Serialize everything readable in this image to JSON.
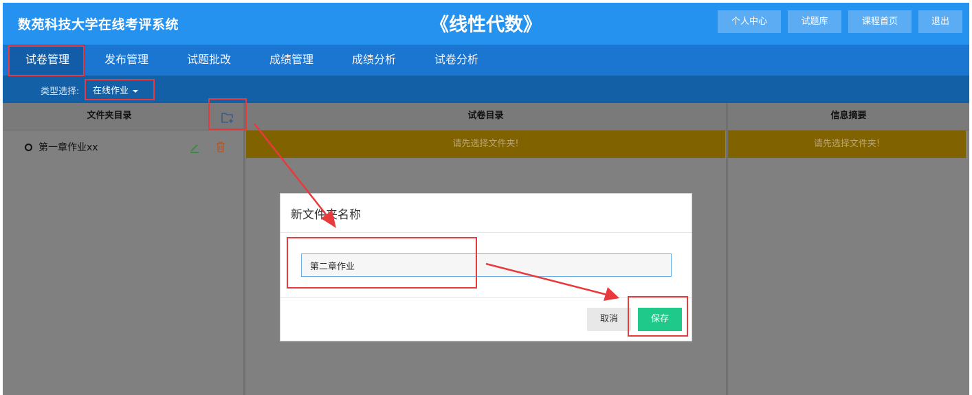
{
  "header": {
    "brand": "数苑科技大学在线考评系统",
    "course_title": "《线性代数》",
    "buttons": [
      "个人中心",
      "试题库",
      "课程首页",
      "退出"
    ]
  },
  "nav": {
    "tabs": [
      "试卷管理",
      "发布管理",
      "试题批改",
      "成绩管理",
      "成绩分析",
      "试卷分析"
    ],
    "active": "试卷管理"
  },
  "typebar": {
    "label": "类型选择:",
    "value": "在线作业"
  },
  "panels": {
    "folder_header": "文件夹目录",
    "paper_header": "试卷目录",
    "summary_header": "信息摘要",
    "paper_warning": "请先选择文件夹!",
    "summary_warning": "请先选择文件夹!"
  },
  "folders": [
    {
      "name": "第一章作业xx"
    }
  ],
  "modal": {
    "title": "新文件夹名称",
    "input_value": "第二章作业",
    "cancel_label": "取消",
    "save_label": "保存"
  },
  "colors": {
    "header_bg": "#2592ef",
    "nav_bg": "#1b76d1",
    "typebar_bg": "#1360a6",
    "warning_bg": "#806200",
    "save_green": "#1ec98a",
    "annotation_red": "#e8393c"
  },
  "icons": {
    "add_folder": "folder-plus-icon",
    "edit": "pencil-icon",
    "delete": "trash-icon"
  }
}
